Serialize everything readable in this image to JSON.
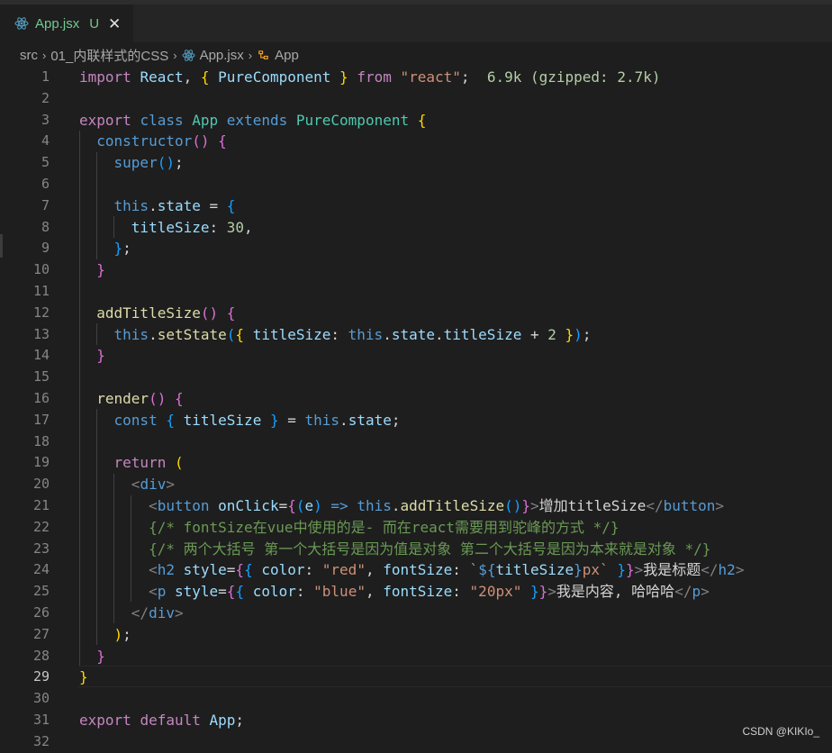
{
  "tab": {
    "title": "App.jsx",
    "status": "U",
    "close": "✕",
    "icon": "react-icon"
  },
  "breadcrumb": {
    "items": [
      "src",
      "01_内联样式的CSS",
      "App.jsx",
      "App"
    ],
    "separator": "›"
  },
  "import_cost_hint": "6.9k (gzipped: 2.7k)",
  "line_numbers": [
    "1",
    "2",
    "3",
    "4",
    "5",
    "6",
    "7",
    "8",
    "9",
    "10",
    "11",
    "12",
    "13",
    "14",
    "15",
    "16",
    "17",
    "18",
    "19",
    "20",
    "21",
    "22",
    "23",
    "24",
    "25",
    "26",
    "27",
    "28",
    "29",
    "30",
    "31",
    "32"
  ],
  "code": {
    "l1": {
      "kw": "import",
      "ident": "React",
      "comp": "PureComponent",
      "from": "from",
      "src": "\"react\""
    },
    "l3": {
      "export": "export",
      "cls": "class",
      "name": "App",
      "ext": "extends",
      "base": "PureComponent"
    },
    "l4": {
      "fn": "constructor"
    },
    "l5": {
      "fn": "super"
    },
    "l7": {
      "this": "this",
      "prop": "state"
    },
    "l8": {
      "key": "titleSize",
      "val": "30"
    },
    "l12": {
      "fn": "addTitleSize"
    },
    "l13": {
      "this": "this",
      "fn": "setState",
      "key": "titleSize",
      "this2": "this",
      "p1": "state",
      "p2": "titleSize",
      "num": "2"
    },
    "l16": {
      "fn": "render"
    },
    "l17": {
      "kw": "const",
      "var": "titleSize",
      "this": "this",
      "prop": "state"
    },
    "l19": {
      "kw": "return"
    },
    "l20": {
      "tag": "div"
    },
    "l21": {
      "tag": "button",
      "attr": "onClick",
      "param": "e",
      "this": "this",
      "fn": "addTitleSize",
      "text": "增加titleSize",
      "close": "button"
    },
    "l22": {
      "comment": "/* fontSize在vue中使用的是- 而在react需要用到驼峰的方式 */"
    },
    "l23": {
      "comment": "/* 两个大括号 第一个大括号是因为值是对象 第二个大括号是因为本来就是对象 */"
    },
    "l24": {
      "tag": "h2",
      "attr": "style",
      "k1": "color",
      "s1": "\"red\"",
      "k2": "fontSize",
      "tpl1": "`",
      "tvar": "titleSize",
      "tpl2": "px`",
      "text": "我是标题",
      "close": "h2"
    },
    "l25": {
      "tag": "p",
      "attr": "style",
      "k1": "color",
      "s1": "\"blue\"",
      "k2": "fontSize",
      "s2": "\"20px\"",
      "text": "我是内容, 哈哈哈",
      "close": "p"
    },
    "l26": {
      "tag": "div"
    },
    "l31": {
      "export": "export",
      "def": "default",
      "name": "App"
    }
  },
  "watermark": "CSDN @KIKIo_",
  "colors": {
    "keyword": "#c586c0",
    "storage": "#569cd6",
    "class": "#4ec9b0",
    "function": "#dcdcaa",
    "variable": "#9cdcfe",
    "string": "#ce9178",
    "comment": "#6a9955",
    "modified": "#73c991"
  }
}
